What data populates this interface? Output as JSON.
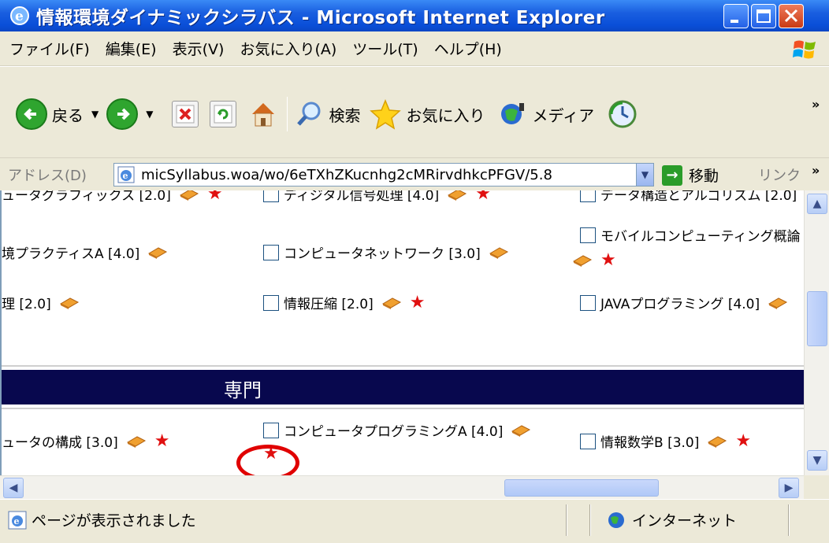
{
  "window": {
    "title": "情報環境ダイナミックシラバス - Microsoft Internet Explorer"
  },
  "menu": [
    "ファイル(F)",
    "編集(E)",
    "表示(V)",
    "お気に入り(A)",
    "ツール(T)",
    "ヘルプ(H)"
  ],
  "toolbar": {
    "back": "戻る",
    "search": "検索",
    "favorites": "お気に入り",
    "media": "メディア"
  },
  "address": {
    "label": "アドレス(D)",
    "value": "micSyllabus.woa/wo/6eTXhZKucnhg2cMRirvdhkcPFGV/5.8",
    "go": "移動",
    "links": "リンク"
  },
  "courses_top": [
    {
      "text": "ュータグラフィックス [2.0]"
    },
    {
      "text": "ディジタル信号処理 [4.0]"
    },
    {
      "text": "データ構造とアルゴリズム [2.0]"
    }
  ],
  "courses_row2": [
    {
      "text": "境プラクティスA [4.0]"
    },
    {
      "text": "コンピュータネットワーク [3.0]"
    },
    {
      "text": "モバイルコンピューティング概論"
    }
  ],
  "courses_row3": [
    {
      "text": "理 [2.0]"
    },
    {
      "text": "情報圧縮 [2.0]"
    },
    {
      "text": "JAVAプログラミング [4.0]"
    }
  ],
  "section": {
    "title": "専門"
  },
  "courses_section": [
    {
      "text": "ュータの構成 [3.0]"
    },
    {
      "text": "コンピュータプログラミングA [4.0]"
    },
    {
      "text": "情報数学B [3.0]"
    }
  ],
  "status": {
    "text": "ページが表示されました",
    "zone": "インターネット"
  },
  "colors": {
    "title_bar": "#0a4fd8",
    "section_header": "#08084e",
    "star": "#e01010",
    "highlight": "#e00000"
  }
}
